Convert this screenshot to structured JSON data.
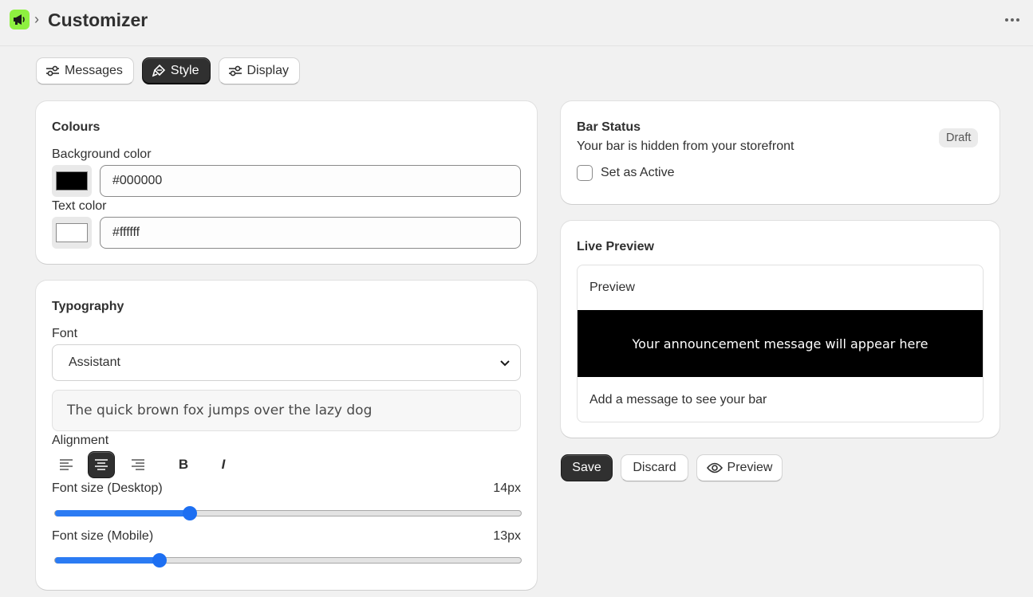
{
  "header": {
    "app_icon": "megaphone-icon",
    "breadcrumb_separator": "›",
    "title": "Customizer",
    "more_icon": "ellipsis-icon"
  },
  "tabs": [
    {
      "label": "Messages",
      "icon": "sliders-icon",
      "active": false
    },
    {
      "label": "Style",
      "icon": "paint-brush-icon",
      "active": true
    },
    {
      "label": "Display",
      "icon": "sliders-icon",
      "active": false
    }
  ],
  "colours": {
    "title": "Colours",
    "background": {
      "label": "Background color",
      "value": "#000000"
    },
    "text": {
      "label": "Text color",
      "value": "#ffffff"
    }
  },
  "typography": {
    "title": "Typography",
    "font_label": "Font",
    "font_value": "Assistant",
    "sample_text": "The quick brown fox jumps over the lazy dog",
    "alignment_label": "Alignment",
    "alignment_options": [
      "left",
      "center",
      "right"
    ],
    "alignment_selected": "center",
    "bold_label": "B",
    "italic_label": "I",
    "desktop_label": "Font size (Desktop)",
    "desktop_value": "14px",
    "desktop_fraction": 0.29,
    "mobile_label": "Font size (Mobile)",
    "mobile_value": "13px",
    "mobile_fraction": 0.224
  },
  "status": {
    "title": "Bar Status",
    "description": "Your bar is hidden from your storefront",
    "badge": "Draft",
    "checkbox_label": "Set as Active",
    "checked": false
  },
  "live_preview": {
    "title": "Live Preview",
    "preview_label": "Preview",
    "bar_message": "Your announcement message will appear here",
    "hint": "Add a message to see your bar"
  },
  "actions": {
    "save": "Save",
    "discard": "Discard",
    "preview": "Preview"
  },
  "colors": {
    "accent": "#303030",
    "slider": "#1d6ff2",
    "app_icon_bg": "#8ef040",
    "bar_bg": "#000000",
    "bar_text": "#ffffff"
  }
}
